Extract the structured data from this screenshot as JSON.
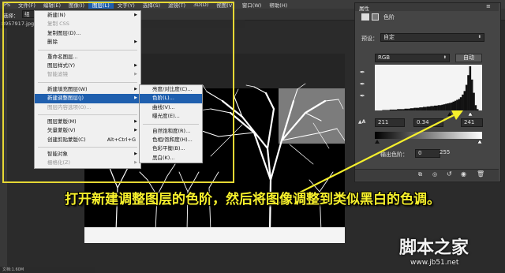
{
  "menubar": {
    "items": [
      {
        "label": "PS"
      },
      {
        "label": "文件(F)"
      },
      {
        "label": "编辑(E)"
      },
      {
        "label": "图像(I)"
      },
      {
        "label": "图层(L)"
      },
      {
        "label": "文字(Y)"
      },
      {
        "label": "选择(S)"
      },
      {
        "label": "滤镜(T)"
      },
      {
        "label": "3D(D)"
      },
      {
        "label": "视图(V)"
      },
      {
        "label": "窗口(W)"
      },
      {
        "label": "帮助(H)"
      }
    ]
  },
  "options_bar": {
    "select_label": "选择：",
    "select_value": "组"
  },
  "doc_tab": {
    "label": "8957917.jpg @"
  },
  "layer_menu": {
    "items": [
      {
        "label": "新建(N)",
        "submenu": true
      },
      {
        "label": "复制 CSS",
        "disabled": true
      },
      {
        "label": "复制图层(D)..."
      },
      {
        "label": "删除",
        "submenu": true
      },
      {
        "sep": true
      },
      {
        "label": "重命名图层..."
      },
      {
        "label": "图层样式(Y)",
        "submenu": true
      },
      {
        "label": "智能滤镜",
        "disabled": true,
        "submenu": true
      },
      {
        "sep": true
      },
      {
        "label": "新建填充图层(W)",
        "submenu": true
      },
      {
        "label": "新建调整图层(J)",
        "submenu": true,
        "highlight": true
      },
      {
        "label": "图层内容选项(O)...",
        "disabled": true
      },
      {
        "sep": true
      },
      {
        "label": "图层蒙版(M)",
        "submenu": true
      },
      {
        "label": "矢量蒙版(V)",
        "submenu": true
      },
      {
        "label": "创建剪贴蒙版(C)",
        "shortcut": "Alt+Ctrl+G"
      },
      {
        "sep": true
      },
      {
        "label": "智能对象",
        "submenu": true
      },
      {
        "label": "栅格化(Z)",
        "disabled": true,
        "submenu": true
      }
    ]
  },
  "adjust_submenu": {
    "items": [
      {
        "label": "亮度/对比度(C)..."
      },
      {
        "label": "色阶(L)...",
        "highlight": true
      },
      {
        "label": "曲线(V)..."
      },
      {
        "label": "曝光度(E)..."
      },
      {
        "sep": true
      },
      {
        "label": "自然饱和度(R)..."
      },
      {
        "label": "色相/饱和度(H)..."
      },
      {
        "label": "色彩平衡(B)..."
      },
      {
        "label": "黑白(K)..."
      }
    ]
  },
  "properties_panel": {
    "tab_label": "属性",
    "title": "色阶",
    "preset_label": "预设：",
    "preset_value": "自定",
    "channel_value": "RGB",
    "auto_label": "自动",
    "input_black": "211",
    "input_gamma": "0.34",
    "input_white": "241",
    "output_label": "输出色阶：",
    "output_black": "0",
    "output_white": "255",
    "histogram": [
      0,
      0,
      0,
      0,
      1,
      1,
      1,
      1,
      2,
      2,
      2,
      2,
      3,
      3,
      3,
      3,
      4,
      4,
      4,
      5,
      5,
      6,
      6,
      6,
      7,
      7,
      8,
      8,
      9,
      9,
      10,
      10,
      11,
      11,
      12,
      12,
      13,
      14,
      15,
      16,
      17,
      18,
      20,
      22,
      24,
      26,
      30,
      36,
      44,
      58,
      80,
      100,
      70,
      40,
      12,
      3,
      0,
      0
    ]
  },
  "caption": "打开新建调整图层的色阶，然后将图像调整到类似黑白的色调。",
  "watermark": {
    "title": "脚本之家",
    "url": "www.jb51.net"
  },
  "status": {
    "text": "文档:1.60M"
  },
  "colors": {
    "highlight": "#1f5fae",
    "frame": "#e6d834",
    "caption": "#f6f02c"
  }
}
